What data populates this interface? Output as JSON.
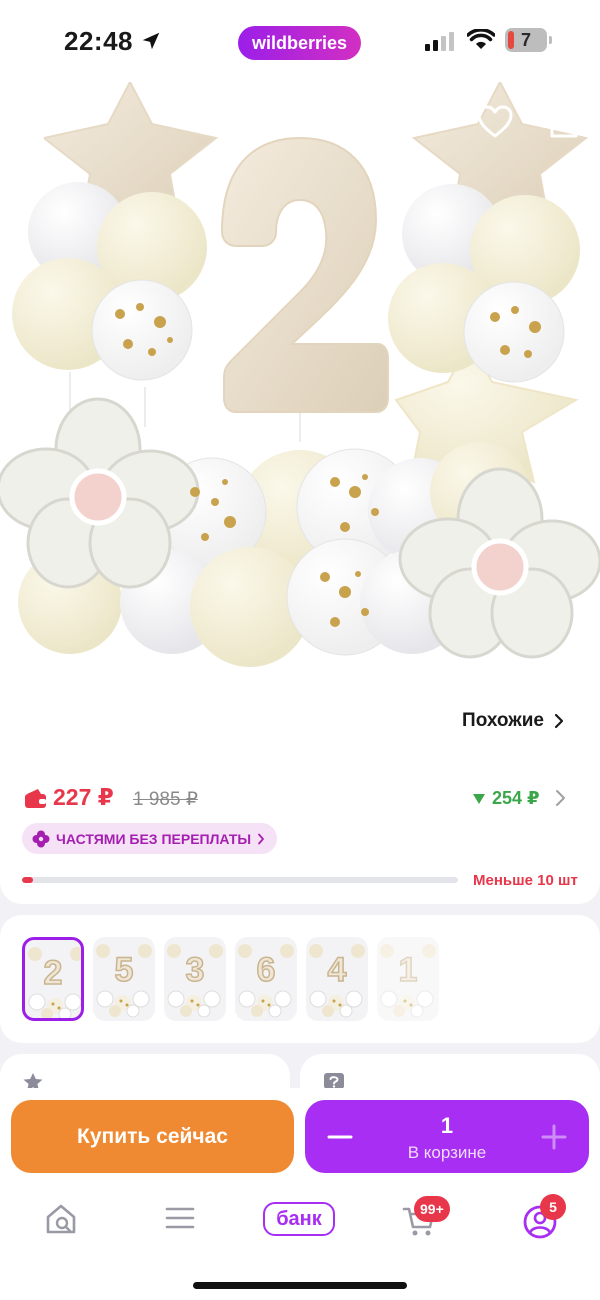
{
  "status_bar": {
    "time": "22:48",
    "center_pill": "wildberries",
    "battery": "7",
    "icons": [
      "location-arrow-icon",
      "signal-icon",
      "wifi-icon",
      "battery-icon"
    ]
  },
  "product": {
    "image_icons": [
      "back-icon",
      "heart-icon",
      "share-icon"
    ]
  },
  "similar": {
    "label": "Похожие"
  },
  "pricing": {
    "price": "227 ₽",
    "old_price": "1 985 ₽",
    "alt_price": "254 ₽",
    "installments": "ЧАСТЯМИ БЕЗ ПЕРЕПЛАТЫ",
    "stock_text": "Меньше 10 шт",
    "stock_level": 0.025,
    "colors": {
      "price": "#e8364a",
      "alt_price": "#3ca74a",
      "accent": "#a72ef2"
    }
  },
  "variants": [
    {
      "number": "2",
      "selected": true
    },
    {
      "number": "5",
      "selected": false
    },
    {
      "number": "3",
      "selected": false
    },
    {
      "number": "6",
      "selected": false
    },
    {
      "number": "4",
      "selected": false
    },
    {
      "number": "1",
      "selected": false
    }
  ],
  "buy_bar": {
    "buy_now": "Купить сейчас",
    "quantity": "1",
    "in_cart": "В корзине",
    "colors": {
      "buy_now": "#f08a32",
      "cart": "#a72ef2"
    }
  },
  "tab_bar": {
    "bank_label": "банк",
    "cart_badge": "99+",
    "profile_badge": "5",
    "icons": [
      "home-search-icon",
      "menu-icon",
      "cart-icon",
      "profile-icon"
    ]
  }
}
